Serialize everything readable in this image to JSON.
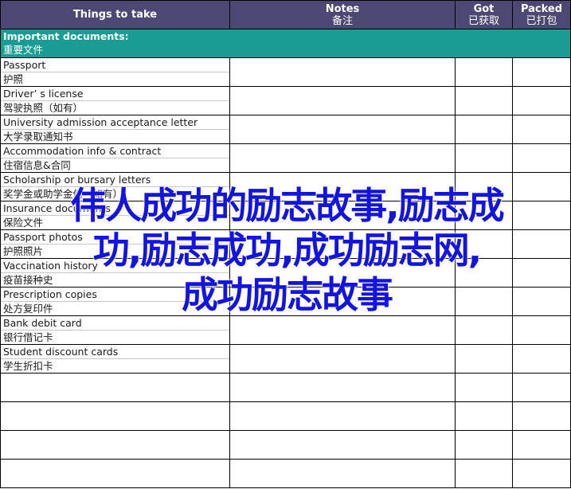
{
  "header": {
    "things": "Things to take",
    "notes_en": "Notes",
    "notes_zh": "备注",
    "got_en": "Got",
    "got_zh": "已获取",
    "packed_en": "Packed",
    "packed_zh": "已打包"
  },
  "section": {
    "title_en": "Important documents:",
    "title_zh": "重要文件"
  },
  "items": [
    {
      "en": "Passport",
      "zh": "护照"
    },
    {
      "en": "Driver’ s license",
      "zh": "驾驶执照（如有）"
    },
    {
      "en": "University admission acceptance letter",
      "zh": "大学录取通知书"
    },
    {
      "en": "Accommodation info & contract",
      "zh": "住宿信息&合同"
    },
    {
      "en": "Scholarship or bursary letters",
      "zh": "奖学金或助学金信（如有）"
    },
    {
      "en": "Insurance documents",
      "zh": "保险文件"
    },
    {
      "en": "Passport photos",
      "zh": "护照照片"
    },
    {
      "en": "Vaccination history",
      "zh": "疫苗接种史"
    },
    {
      "en": "Prescription copies",
      "zh": "处方复印件"
    },
    {
      "en": "Bank debit card",
      "zh": "银行借记卡"
    },
    {
      "en": "Student discount cards",
      "zh": "学生折扣卡"
    }
  ],
  "watermark": {
    "line1": "伟人成功的励志故事,励志成",
    "line2": "功,励志成功,成功励志网,",
    "line3": "成功励志故事"
  },
  "colors": {
    "header_bg": "#4d4773",
    "section_bg": "#1a9c95",
    "watermark": "#1414e0"
  }
}
